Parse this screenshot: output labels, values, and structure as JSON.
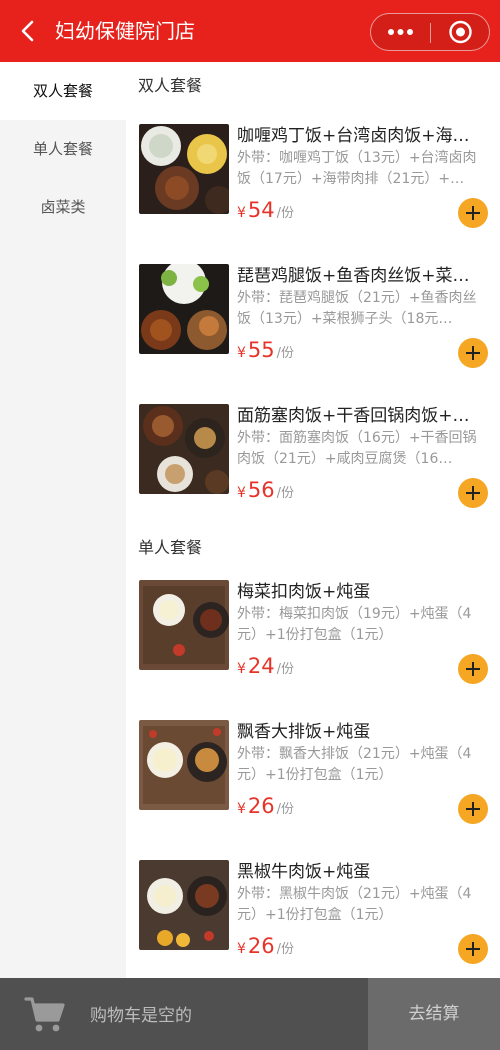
{
  "header": {
    "title": "妇幼保健院门店"
  },
  "icons": {
    "back": "chevron-left-icon",
    "more": "more-dots-icon",
    "close": "target-close-icon",
    "cart": "shopping-cart-icon",
    "add": "plus-icon"
  },
  "colors": {
    "header_bg": "#e7221c",
    "price": "#e7342a",
    "add_button": "#f5a623",
    "cart_bar": "#505050"
  },
  "sidebar": {
    "items": [
      {
        "label": "双人套餐",
        "active": true
      },
      {
        "label": "单人套餐",
        "active": false
      },
      {
        "label": "卤菜类",
        "active": false
      }
    ]
  },
  "sections": [
    {
      "title": "双人套餐",
      "products": [
        {
          "name": "咖喱鸡丁饭+台湾卤肉饭+海…",
          "desc": "外带：咖喱鸡丁饭（13元）+台湾卤肉饭（17元）+海带肉排（21元）+…",
          "currency": "¥",
          "price": "54",
          "unit": "/份"
        },
        {
          "name": "琵琶鸡腿饭+鱼香肉丝饭+菜…",
          "desc": "外带：琵琶鸡腿饭（21元）+鱼香肉丝饭（13元）+菜根狮子头（18元…",
          "currency": "¥",
          "price": "55",
          "unit": "/份"
        },
        {
          "name": "面筋塞肉饭+干香回锅肉饭+…",
          "desc": "外带：面筋塞肉饭（16元）+干香回锅肉饭（21元）+咸肉豆腐煲（16…",
          "currency": "¥",
          "price": "56",
          "unit": "/份"
        }
      ]
    },
    {
      "title": "单人套餐",
      "products": [
        {
          "name": "梅菜扣肉饭+炖蛋",
          "desc": "外带：梅菜扣肉饭（19元）+炖蛋（4元）+1份打包盒（1元）",
          "currency": "¥",
          "price": "24",
          "unit": "/份"
        },
        {
          "name": "飘香大排饭+炖蛋",
          "desc": "外带：飘香大排饭（21元）+炖蛋（4元）+1份打包盒（1元）",
          "currency": "¥",
          "price": "26",
          "unit": "/份"
        },
        {
          "name": "黑椒牛肉饭+炖蛋",
          "desc": "外带：黑椒牛肉饭（21元）+炖蛋（4元）+1份打包盒（1元）",
          "currency": "¥",
          "price": "26",
          "unit": "/份"
        }
      ]
    }
  ],
  "cart": {
    "empty_text": "购物车是空的",
    "checkout_label": "去结算"
  }
}
